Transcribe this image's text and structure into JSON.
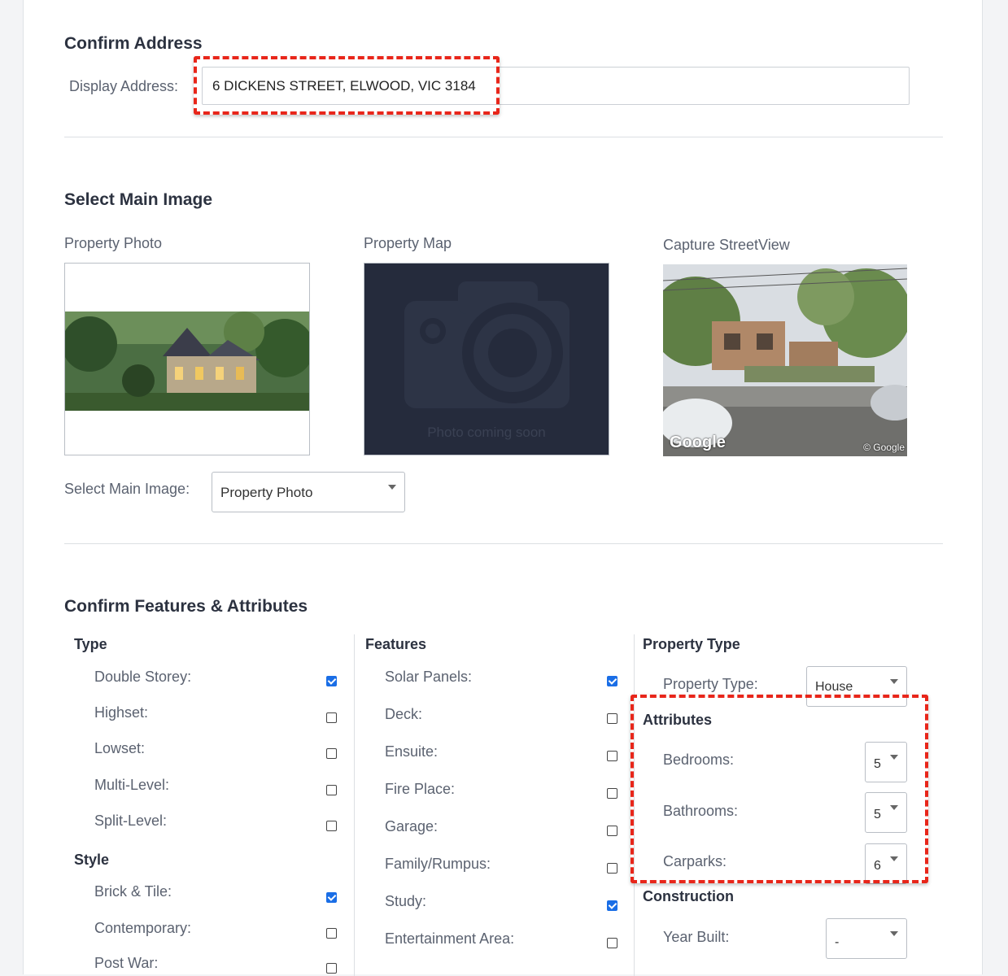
{
  "confirm_address": {
    "title": "Confirm Address",
    "display_address_label": "Display Address:",
    "display_address_value": "6 DICKENS STREET, ELWOOD, VIC 3184"
  },
  "main_image": {
    "title": "Select Main Image",
    "photo_label": "Property Photo",
    "map_label": "Property Map",
    "map_placeholder_text": "Photo coming soon",
    "streetview_label": "Capture StreetView",
    "streetview_watermark": "Google",
    "streetview_copyright": "© Google",
    "select_label": "Select Main Image:",
    "select_value": "Property Photo"
  },
  "features_attributes": {
    "title": "Confirm Features & Attributes",
    "type": {
      "heading": "Type",
      "items": [
        {
          "label": "Double Storey:",
          "checked": true
        },
        {
          "label": "Highset:",
          "checked": false
        },
        {
          "label": "Lowset:",
          "checked": false
        },
        {
          "label": "Multi-Level:",
          "checked": false
        },
        {
          "label": "Split-Level:",
          "checked": false
        }
      ]
    },
    "style": {
      "heading": "Style",
      "items": [
        {
          "label": "Brick & Tile:",
          "checked": true
        },
        {
          "label": "Contemporary:",
          "checked": false
        },
        {
          "label": "Post War:",
          "checked": false
        }
      ]
    },
    "features": {
      "heading": "Features",
      "items": [
        {
          "label": "Solar Panels:",
          "checked": true
        },
        {
          "label": "Deck:",
          "checked": false
        },
        {
          "label": "Ensuite:",
          "checked": false
        },
        {
          "label": "Fire Place:",
          "checked": false
        },
        {
          "label": "Garage:",
          "checked": false
        },
        {
          "label": "Family/Rumpus:",
          "checked": false
        },
        {
          "label": "Study:",
          "checked": true
        },
        {
          "label": "Entertainment Area:",
          "checked": false
        }
      ]
    },
    "property_type": {
      "heading": "Property Type",
      "label": "Property Type:",
      "value": "House"
    },
    "attributes": {
      "heading": "Attributes",
      "bedrooms_label": "Bedrooms:",
      "bedrooms_value": "5",
      "bathrooms_label": "Bathrooms:",
      "bathrooms_value": "5",
      "carparks_label": "Carparks:",
      "carparks_value": "6"
    },
    "construction": {
      "heading": "Construction",
      "year_built_label": "Year Built:",
      "year_built_value": "-"
    }
  },
  "colors": {
    "highlight": "#e8261a",
    "checkbox_checked": "#1a6ee6",
    "map_placeholder_bg": "#252b3c"
  }
}
